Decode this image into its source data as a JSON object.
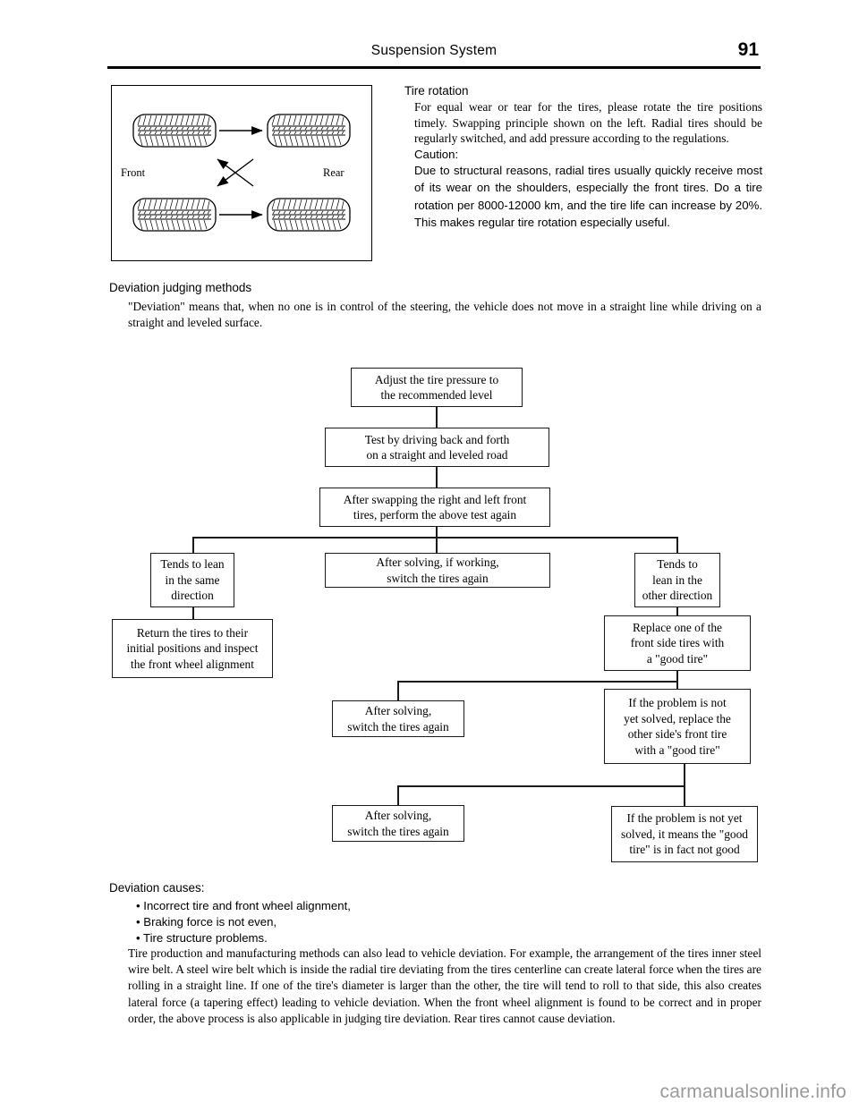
{
  "header": {
    "title": "Suspension System",
    "page_number": "91"
  },
  "figure": {
    "name": "tire-rotation-diagram",
    "front_label": "Front",
    "rear_label": "Rear",
    "tires": [
      {
        "position": "front-left"
      },
      {
        "position": "rear-left"
      },
      {
        "position": "front-right"
      },
      {
        "position": "rear-right"
      }
    ]
  },
  "tire_rotation": {
    "heading": "Tire  rotation",
    "paragraph": "For equal wear or tear for the tires, please rotate the tire positions timely. Swapping principle shown on the left. Radial tires should be regularly switched, and add pressure according to the regulations.",
    "caution_label": "Caution:",
    "caution_text": "Due to structural reasons, radial tires usually quickly receive most of its wear on the shoulders, especially the front tires. Do a tire rotation per 8000-12000 km, and the tire life can increase by 20%. This makes regular tire rotation especially useful."
  },
  "deviation_judging": {
    "heading": "Deviation judging methods",
    "body": "\"Deviation\" means that, when no one is in control of the steering, the vehicle does not move in a straight line while driving on a straight and leveled surface."
  },
  "flowchart": {
    "boxes": [
      {
        "id": "adjust-pressure",
        "text": "Adjust the tire pressure to\nthe recommended level"
      },
      {
        "id": "test-driving",
        "text": "Test by driving back and forth\non a straight and leveled road"
      },
      {
        "id": "after-swapping",
        "text": "After swapping the right and left front\ntires, perform the above test again"
      },
      {
        "id": "tends-same",
        "text": "Tends to lean\nin the same\ndirection"
      },
      {
        "id": "after-solving-working",
        "text": "After solving, if working,\nswitch the tires again"
      },
      {
        "id": "tends-other",
        "text": "Tends to\nlean in the\nother direction"
      },
      {
        "id": "return-tires",
        "text": "Return the tires to their\ninitial positions and inspect\nthe front wheel alignment"
      },
      {
        "id": "replace-one-front",
        "text": "Replace one of the\nfront side tires with\na \"good tire\""
      },
      {
        "id": "after-solving-1",
        "text": "After solving,\nswitch the tires again"
      },
      {
        "id": "not-solved-other-side",
        "text": "If the problem is not\nyet solved, replace the\nother side's front tire\nwith a \"good tire\""
      },
      {
        "id": "after-solving-2",
        "text": "After solving,\nswitch the tires again"
      },
      {
        "id": "good-tire-not-good",
        "text": "If the problem is not yet\nsolved, it means the \"good\ntire\" is in fact not good"
      }
    ]
  },
  "deviation_causes": {
    "heading": "Deviation causes:",
    "items": [
      "• Incorrect tire and front wheel alignment,",
      "• Braking force is not even,",
      "• Tire structure problems."
    ],
    "body": "Tire production and manufacturing methods can also lead to vehicle deviation. For example, the arrangement of the tires inner steel wire belt. A steel wire belt which is inside the radial tire deviating from the tires centerline can create lateral force when the tires are rolling in a straight line. If one of the tire's diameter is larger than the other, the tire will tend to roll to that side, this also creates lateral force (a tapering effect) leading to vehicle deviation. When the front wheel alignment is found to be correct and in proper order, the above process is also applicable in judging tire deviation. Rear tires cannot cause deviation."
  },
  "watermark": {
    "text": "carmanualsonline.info"
  }
}
